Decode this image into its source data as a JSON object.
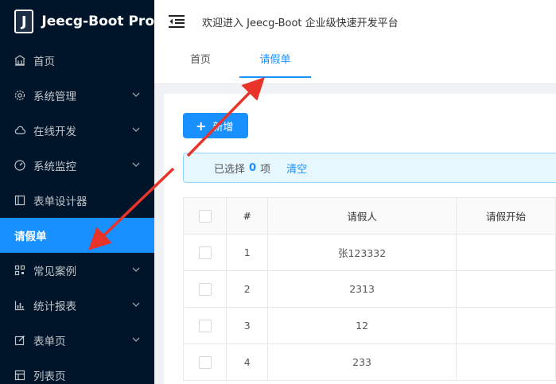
{
  "logo": {
    "letter": "J",
    "text": "Jeecg-Boot Pro"
  },
  "header": {
    "title": "欢迎进入 Jeecg-Boot 企业级快速开发平台"
  },
  "sidebar": {
    "items": [
      {
        "label": "首页",
        "icon": "home-icon"
      },
      {
        "label": "系统管理",
        "icon": "gear-icon"
      },
      {
        "label": "在线开发",
        "icon": "cloud-icon"
      },
      {
        "label": "系统监控",
        "icon": "dashboard-icon"
      },
      {
        "label": "表单设计器",
        "icon": "form-icon"
      },
      {
        "label": "请假单",
        "icon": ""
      },
      {
        "label": "常见案例",
        "icon": "qrcode-icon"
      },
      {
        "label": "统计报表",
        "icon": "bar-chart-icon"
      },
      {
        "label": "表单页",
        "icon": "edit-icon"
      },
      {
        "label": "列表页",
        "icon": "table-icon"
      }
    ]
  },
  "tabs": [
    {
      "label": "首页"
    },
    {
      "label": "请假单"
    }
  ],
  "toolbar": {
    "add_label": "新增"
  },
  "alert": {
    "prefix": "已选择",
    "count": "0",
    "suffix": "项",
    "clear": "清空"
  },
  "table": {
    "headers": [
      "#",
      "请假人",
      "请假开始"
    ],
    "rows": [
      {
        "num": "1",
        "name": "张123332"
      },
      {
        "num": "2",
        "name": "2313"
      },
      {
        "num": "3",
        "name": "12"
      },
      {
        "num": "4",
        "name": "233"
      }
    ]
  },
  "colors": {
    "primary": "#1890ff",
    "sidebar": "#001529",
    "arrow": "#e8332a"
  }
}
